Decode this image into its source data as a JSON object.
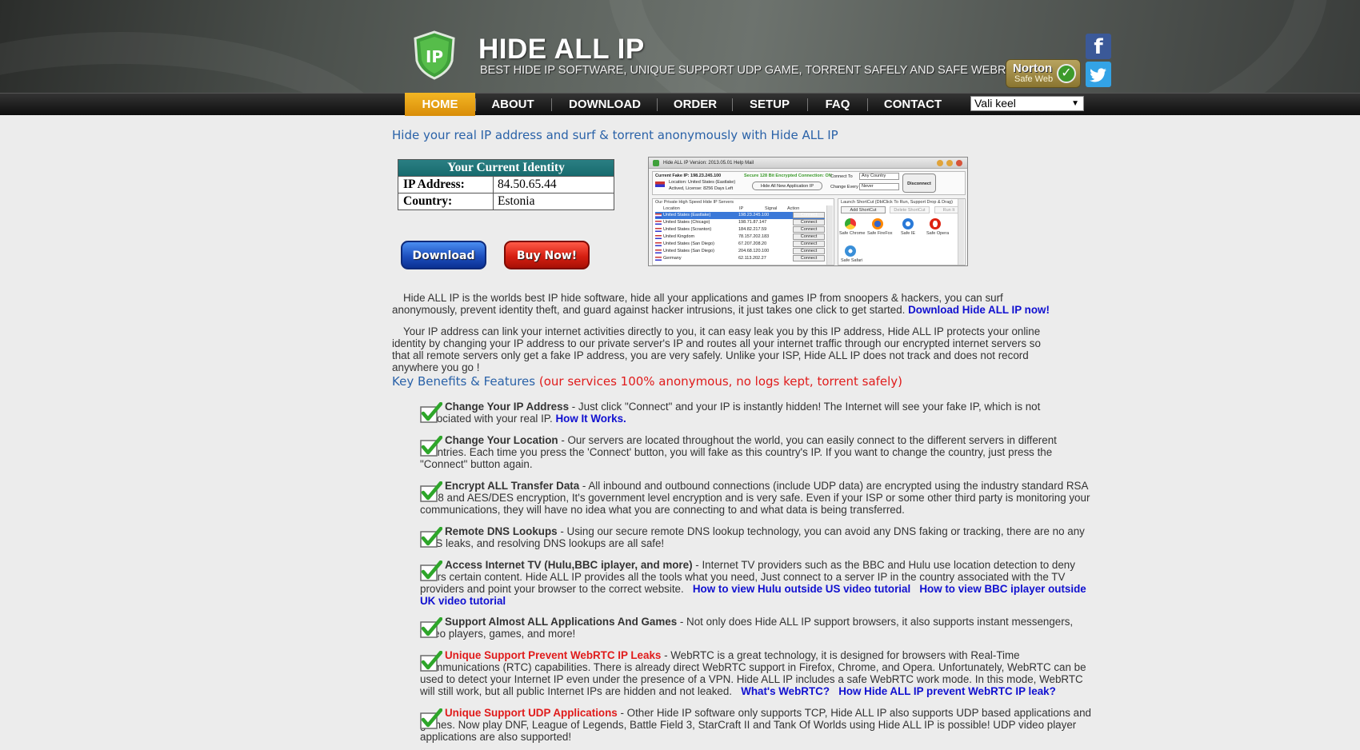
{
  "header": {
    "logo_text": "IP",
    "title": "HIDE ALL IP",
    "tagline": "BEST HIDE IP SOFTWARE, UNIQUE SUPPORT UDP GAME, TORRENT SAFELY AND SAFE WEBRTC",
    "norton_name": "Norton",
    "norton_sub": "Safe Web",
    "facebook_icon": "facebook-icon",
    "twitter_icon": "twitter-icon"
  },
  "nav": {
    "items": [
      "HOME",
      "ABOUT",
      "DOWNLOAD",
      "ORDER",
      "SETUP",
      "FAQ",
      "CONTACT"
    ],
    "active": "HOME",
    "language": "Vali keel"
  },
  "main": {
    "heading": "Hide your real IP address and surf & torrent anonymously with Hide ALL IP",
    "identity": {
      "title": "Your Current Identity",
      "ip_label": "IP Address:",
      "ip_value": "84.50.65.44",
      "country_label": "Country:",
      "country_value": "Estonia"
    },
    "download_label": "Download",
    "buynow_label": "Buy Now!",
    "app": {
      "title": "Hide ALL IP  Version: 2013.05.01   Help   Mail",
      "fake_ip": "Current Fake IP: 198.23.245.100",
      "location": "Location: United States (Eastlake)",
      "license": "Actived, License: 8256 Days Left",
      "secure_note": "Secure 128 Bit Encrypted Connection: ON",
      "connect_to_label": "Connect To",
      "connect_to_value": "Any Country",
      "change_every_label": "Change Every",
      "change_every_value": "Never",
      "hide_all_button": "Hide All New Application IP",
      "disconnect_button": "Disconnect",
      "list_title": "Our Private High Speed Hide IP Servers",
      "list_headers": [
        "Location",
        "IP",
        "Signal",
        "Action"
      ],
      "servers": [
        {
          "loc": "United States (Eastlake)",
          "ip": "198.23.245.100"
        },
        {
          "loc": "United States (Chicago)",
          "ip": "198.71.87.147"
        },
        {
          "loc": "United States (Scranton)",
          "ip": "184.82.217.59"
        },
        {
          "loc": "United Kingdom",
          "ip": "78.157.202.183"
        },
        {
          "loc": "United States (San Diego)",
          "ip": "67.207.208.20"
        },
        {
          "loc": "United States (San Diego)",
          "ip": "204.68.120.100"
        },
        {
          "loc": "Germany",
          "ip": "62.113.202.27"
        }
      ],
      "connect_label": "Connect",
      "shortcut_title": "Launch ShortCut (DblClick To Run, Support Drop & Drag)",
      "add_shortcut": "Add ShortCut",
      "delete_shortcut": "Delete ShortCut",
      "run_it": "Run It",
      "shortcuts": [
        "Safe Chrome",
        "Safe FireFox",
        "Safe IE",
        "Safe Opera",
        "Safe Safari"
      ]
    },
    "intro_1": "Hide ALL IP is the worlds best IP hide software, hide all your applications and games IP from snoopers & hackers, you can surf anonymously, prevent identity theft, and guard against hacker intrusions, it just takes one click to get started.",
    "intro_1_link": "Download Hide ALL IP now!",
    "intro_2": "Your IP address can link your internet activities directly to you, it can easy leak you by this IP address, Hide ALL IP protects your online identity by changing your IP address to our private server's IP and routes all your internet traffic through our encrypted internet servers so that all remote servers only get a fake IP address, you are very safely. Unlike your ISP, Hide ALL IP does not track and does not record anywhere you go !",
    "benefits_heading": "Key Benefits & Features",
    "benefits_note": "(our services 100% anonymous, no logs kept, torrent safely)",
    "colors": {
      "heading_blue": "#2a62a8",
      "note_red": "#e01b1b",
      "link_blue": "#1010d0",
      "nav_active": "#f3b624"
    },
    "features": [
      {
        "title": "Change Your IP Address",
        "text": " - Just click \"Connect\" and your IP is instantly hidden! The Internet will see your fake IP, which is not associated with your real IP. ",
        "link1": "How It Works.",
        "link2": ""
      },
      {
        "title": "Change Your Location",
        "text": " - Our servers are located throughout the world, you can easily connect to the different servers in different countries. Each time you press the 'Connect' button, you will fake as this country's IP. If you want to change the country, just press the \"Connect\" button again.",
        "link1": "",
        "link2": ""
      },
      {
        "title": "Encrypt ALL Transfer Data",
        "text": " - All inbound and outbound connections (include UDP data) are encrypted using the industry standard RSA 2048 and AES/DES encryption, It's government level encryption and is very safe. Even if your ISP or some other third party is monitoring your communications, they will have no idea what you are connecting to and what data is being transferred.",
        "link1": "",
        "link2": ""
      },
      {
        "title": "Remote DNS Lookups",
        "text": " - Using our secure remote DNS lookup technology, you can avoid any DNS faking or tracking, there are no any DNS leaks, and resolving DNS lookups are all safe!",
        "link1": "",
        "link2": ""
      },
      {
        "title": "Access Internet TV (Hulu,BBC iplayer, and more)",
        "text": " - Internet TV providers such as the BBC and Hulu use location detection to deny users certain content. Hide ALL IP provides all the tools what you need, Just connect to a server IP in the country associated with the TV providers and point your browser to the correct website.",
        "link1": "How to view Hulu outside US video tutorial",
        "link2": "How to view BBC iplayer outside UK video tutorial"
      },
      {
        "title": "Support Almost ALL Applications And Games",
        "text": " - Not only does Hide ALL IP support browsers, it also supports instant messengers, video players, games, and more!",
        "link1": "",
        "link2": ""
      },
      {
        "title": "Unique Support Prevent WebRTC IP Leaks",
        "text": " - WebRTC is a great technology, it is designed for browsers with Real-Time Communications (RTC) capabilities. There is already direct WebRTC support in Firefox, Chrome, and Opera. Unfortunately, WebRTC can be used to detect your Internet IP even under the presence of a VPN. Hide ALL IP includes a safe WebRTC work mode. In this mode, WebRTC will still work, but all public Internet IPs are hidden and not leaked.",
        "link1": "What's WebRTC?",
        "link2": "How Hide ALL IP prevent WebRTC IP leak?"
      },
      {
        "title": "Unique Support UDP Applications",
        "text": " - Other Hide IP software only supports TCP, Hide ALL IP also supports UDP based applications and games. Now play DNF, League of Legends, Battle Field 3, StarCraft II and Tank Of Worlds using Hide ALL IP is possible! UDP video player applications are also supported!",
        "link1": "",
        "link2": ""
      }
    ]
  }
}
